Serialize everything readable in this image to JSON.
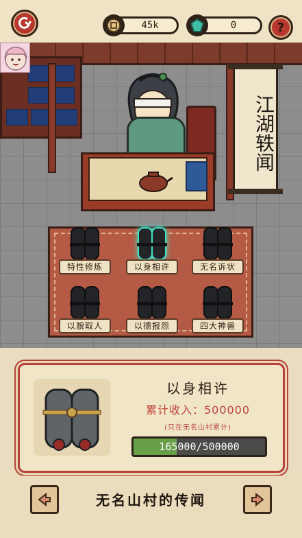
{
  "top_bar": {
    "coins": "45k",
    "gems": "0",
    "back_icon": "back-arrow-icon",
    "help_icon": "question-icon",
    "coin_icon": "coin-icon",
    "gem_icon": "gem-icon"
  },
  "scene": {
    "banner_text": "江湖轶闻"
  },
  "menu": {
    "items": [
      {
        "label": "特性修炼",
        "selected": false
      },
      {
        "label": "以身相许",
        "selected": true
      },
      {
        "label": "无名诉状",
        "selected": false
      },
      {
        "label": "以貌取人",
        "selected": false
      },
      {
        "label": "以德报怨",
        "selected": false
      },
      {
        "label": "四大神兽",
        "selected": false
      }
    ]
  },
  "info": {
    "title": "以身相许",
    "income_text": "累计收入：500000",
    "note": "(只在无名山村累计)",
    "progress_text": "165000/500000",
    "progress_current": 165000,
    "progress_total": 500000,
    "progress_color": "#68a04a"
  },
  "bottom": {
    "title": "无名山村的传闻",
    "prev_icon": "arrow-left-icon",
    "next_icon": "arrow-right-icon"
  },
  "colors": {
    "accent_red": "#b8372f",
    "text_red": "#c0443a",
    "panel_bg": "#f1e5c7",
    "selected_glow": "#3fe2c4"
  }
}
